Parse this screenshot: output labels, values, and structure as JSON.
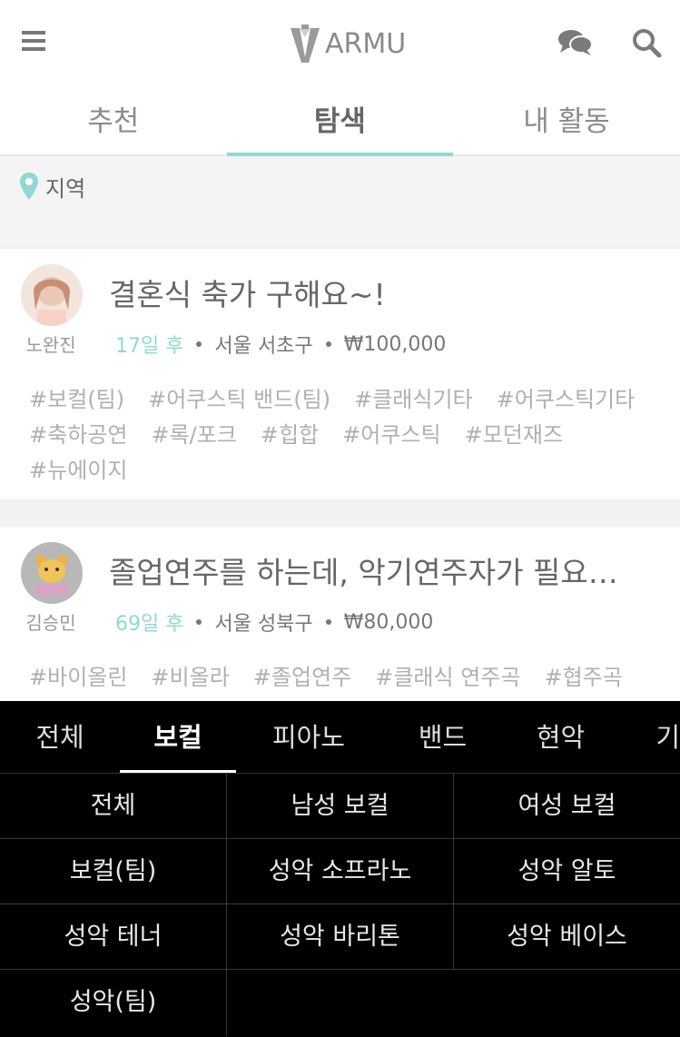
{
  "header": {
    "logo_text": "ARMU",
    "icons": [
      "menu-icon",
      "chat-icon",
      "search-icon"
    ]
  },
  "tabs": [
    {
      "label": "추천",
      "active": false
    },
    {
      "label": "탐색",
      "active": true
    },
    {
      "label": "내 활동",
      "active": false
    }
  ],
  "region": {
    "label": "지역",
    "icon": "pin-icon"
  },
  "posts": [
    {
      "username": "노완진",
      "title": "결혼식 축가 구해요~!",
      "days": "17일 후",
      "location": "서울 서초구",
      "price": "₩100,000",
      "tags": [
        "#보컬(팀)",
        "#어쿠스틱 밴드(팀)",
        "#클래식기타",
        "#어쿠스틱기타",
        "#축하공연",
        "#록/포크",
        "#힙합",
        "#어쿠스틱",
        "#모던재즈",
        "#뉴에이지"
      ]
    },
    {
      "username": "김승민",
      "title": "졸업연주를 하는데, 악기연주자가 필요…",
      "days": "69일 후",
      "location": "서울 성북구",
      "price": "₩80,000",
      "tags": [
        "#바이올린",
        "#비올라",
        "#졸업연주",
        "#클래식 연주곡",
        "#협주곡"
      ]
    }
  ],
  "category_tabs": [
    {
      "label": "전체",
      "active": false
    },
    {
      "label": "보컬",
      "active": true
    },
    {
      "label": "피아노",
      "active": false
    },
    {
      "label": "밴드",
      "active": false
    },
    {
      "label": "현악",
      "active": false
    },
    {
      "label": "기",
      "active": false
    }
  ],
  "subcategories": [
    "전체",
    "남성 보컬",
    "여성 보컬",
    "보컬(팀)",
    "성악 소프라노",
    "성악 알토",
    "성악 테너",
    "성악 바리톤",
    "성악 베이스",
    "성악(팀)"
  ],
  "colors": {
    "accent": "#8fd8d3",
    "panel": "#000000"
  }
}
